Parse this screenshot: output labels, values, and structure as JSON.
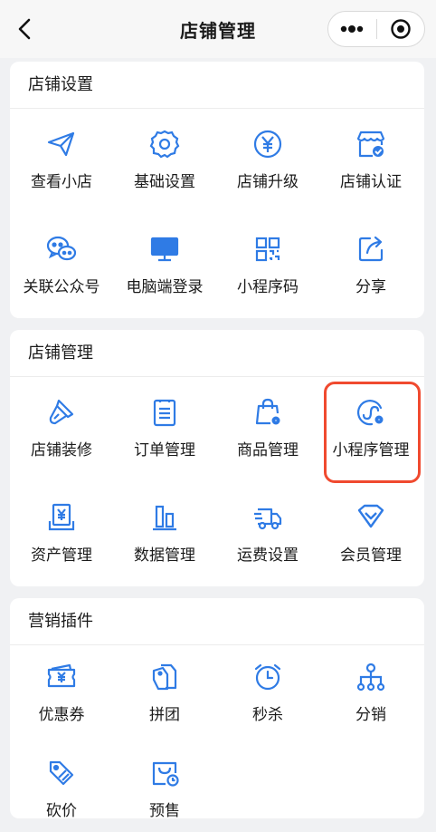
{
  "nav": {
    "title": "店铺管理"
  },
  "sections": [
    {
      "title": "店铺设置",
      "items": [
        {
          "label": "查看小店",
          "icon": "send-icon"
        },
        {
          "label": "基础设置",
          "icon": "gear-icon"
        },
        {
          "label": "店铺升级",
          "icon": "yen-circle-icon"
        },
        {
          "label": "店铺认证",
          "icon": "store-verified-icon"
        },
        {
          "label": "关联公众号",
          "icon": "wechat-icon"
        },
        {
          "label": "电脑端登录",
          "icon": "monitor-icon"
        },
        {
          "label": "小程序码",
          "icon": "qrcode-icon"
        },
        {
          "label": "分享",
          "icon": "share-icon"
        }
      ]
    },
    {
      "title": "店铺管理",
      "items": [
        {
          "label": "店铺装修",
          "icon": "brush-icon"
        },
        {
          "label": "订单管理",
          "icon": "order-list-icon"
        },
        {
          "label": "商品管理",
          "icon": "shopping-bag-gear-icon"
        },
        {
          "label": "小程序管理",
          "icon": "miniprogram-gear-icon"
        },
        {
          "label": "资产管理",
          "icon": "asset-yen-icon"
        },
        {
          "label": "数据管理",
          "icon": "bar-chart-icon"
        },
        {
          "label": "运费设置",
          "icon": "truck-icon"
        },
        {
          "label": "会员管理",
          "icon": "member-diamond-icon"
        }
      ]
    },
    {
      "title": "营销插件",
      "items": [
        {
          "label": "优惠券",
          "icon": "coupon-icon"
        },
        {
          "label": "拼团",
          "icon": "group-tag-icon"
        },
        {
          "label": "秒杀",
          "icon": "alarm-clock-icon"
        },
        {
          "label": "分销",
          "icon": "distribution-tree-icon"
        },
        {
          "label": "砍价",
          "icon": "bargain-tag-icon"
        },
        {
          "label": "预售",
          "icon": "presale-bag-icon"
        }
      ]
    }
  ],
  "colors": {
    "icon": "#2f7be5",
    "highlight": "#f04a2f"
  }
}
